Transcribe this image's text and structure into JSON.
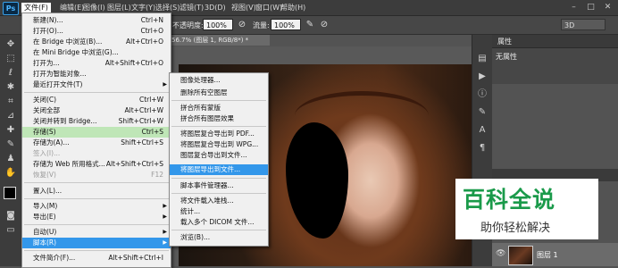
{
  "app": {
    "logo": "Ps"
  },
  "menubar": {
    "items": [
      "文件(F)",
      "编辑(E)",
      "图像(I)",
      "图层(L)",
      "文字(Y)",
      "选择(S)",
      "滤镜(T)",
      "3D(D)",
      "视图(V)",
      "窗口(W)",
      "帮助(H)"
    ]
  },
  "optionsbar": {
    "opacity_label": "不透明度:",
    "opacity_value": "100%",
    "flow_label": "流量:",
    "flow_value": "100%",
    "mode_3d": "3D"
  },
  "document": {
    "tab_title": "56.7% (图层 1, RGB/8*) *"
  },
  "file_menu": {
    "items": [
      {
        "label": "新建(N)...",
        "shortcut": "Ctrl+N"
      },
      {
        "label": "打开(O)...",
        "shortcut": "Ctrl+O"
      },
      {
        "label": "在 Bridge 中浏览(B)...",
        "shortcut": "Alt+Ctrl+O"
      },
      {
        "label": "在 Mini Bridge 中浏览(G)...",
        "shortcut": ""
      },
      {
        "label": "打开为...",
        "shortcut": "Alt+Shift+Ctrl+O"
      },
      {
        "label": "打开为智能对象...",
        "shortcut": ""
      },
      {
        "label": "最近打开文件(T)",
        "shortcut": "",
        "arrow": "▶"
      },
      {
        "label": "关闭(C)",
        "shortcut": "Ctrl+W"
      },
      {
        "label": "关闭全部",
        "shortcut": "Alt+Ctrl+W"
      },
      {
        "label": "关闭并转到 Bridge...",
        "shortcut": "Shift+Ctrl+W"
      },
      {
        "label": "存储(S)",
        "shortcut": "Ctrl+S"
      },
      {
        "label": "存储为(A)...",
        "shortcut": "Shift+Ctrl+S"
      },
      {
        "label": "签入(I)...",
        "shortcut": ""
      },
      {
        "label": "存储为 Web 所用格式...",
        "shortcut": "Alt+Shift+Ctrl+S"
      },
      {
        "label": "恢复(V)",
        "shortcut": "F12"
      },
      {
        "label": "置入(L)...",
        "shortcut": ""
      },
      {
        "label": "导入(M)",
        "shortcut": "",
        "arrow": "▶"
      },
      {
        "label": "导出(E)",
        "shortcut": "",
        "arrow": "▶"
      },
      {
        "label": "自动(U)",
        "shortcut": "",
        "arrow": "▶"
      },
      {
        "label": "脚本(R)",
        "shortcut": "",
        "arrow": "▶"
      },
      {
        "label": "文件简介(F)...",
        "shortcut": "Alt+Shift+Ctrl+I"
      }
    ]
  },
  "scripts_menu": {
    "items": [
      "图像处理器...",
      "删除所有空图层",
      "拼合所有蒙版",
      "拼合所有图层效果",
      "将图层复合导出到 PDF...",
      "将图层复合导出到 WPG...",
      "图层复合导出到文件...",
      "将图层导出到文件...",
      "脚本事件管理器...",
      "将文件载入堆栈...",
      "统计...",
      "载入多个 DICOM 文件...",
      "浏览(B)..."
    ]
  },
  "properties_panel": {
    "tab": "属性",
    "empty_label": "无属性"
  },
  "layers_panel": {
    "layer_name": "图层 1"
  },
  "watermark": {
    "title": "百科全说",
    "subtitle": "助你轻松解决"
  },
  "colors": {
    "menu_highlight": "#3397ea",
    "save_highlight": "#bfe6b7",
    "watermark_green": "#1a9a4a"
  }
}
